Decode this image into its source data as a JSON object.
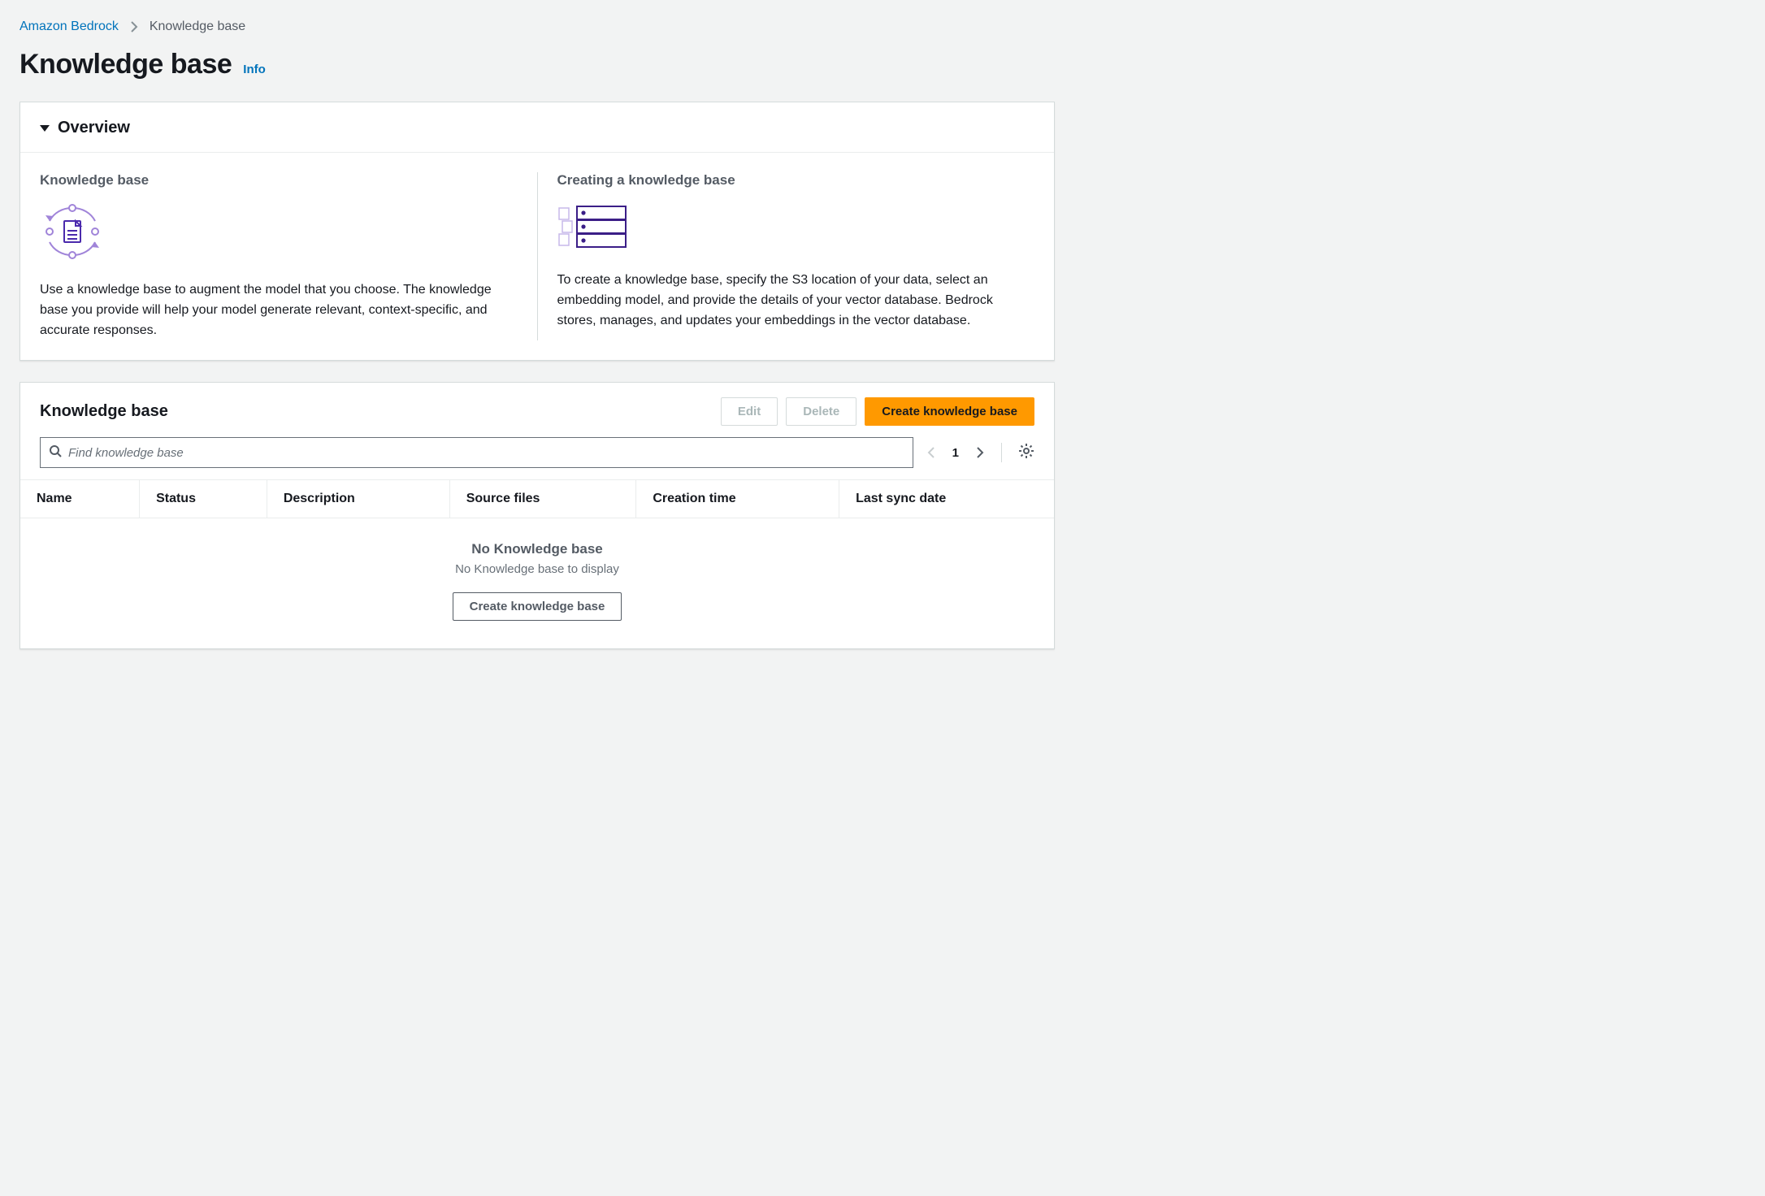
{
  "breadcrumb": {
    "root": "Amazon Bedrock",
    "current": "Knowledge base"
  },
  "page": {
    "title": "Knowledge base",
    "info": "Info"
  },
  "overview": {
    "header": "Overview",
    "left": {
      "heading": "Knowledge base",
      "text": "Use a knowledge base to augment the model that you choose. The knowledge base you provide will help your model generate relevant, context-specific, and accurate responses."
    },
    "right": {
      "heading": "Creating a knowledge base",
      "text": "To create a knowledge base, specify the S3 location of your data, select an embedding model, and provide the details of your vector database. Bedrock stores, manages, and updates your embeddings in the vector database."
    }
  },
  "kb": {
    "title": "Knowledge base",
    "actions": {
      "edit": "Edit",
      "delete": "Delete",
      "create": "Create knowledge base"
    },
    "search_placeholder": "Find knowledge base",
    "pagination": {
      "page": "1"
    },
    "columns": {
      "name": "Name",
      "status": "Status",
      "description": "Description",
      "source_files": "Source files",
      "creation_time": "Creation time",
      "last_sync": "Last sync date"
    },
    "empty": {
      "title": "No Knowledge base",
      "subtitle": "No Knowledge base to display",
      "cta": "Create knowledge base"
    }
  }
}
